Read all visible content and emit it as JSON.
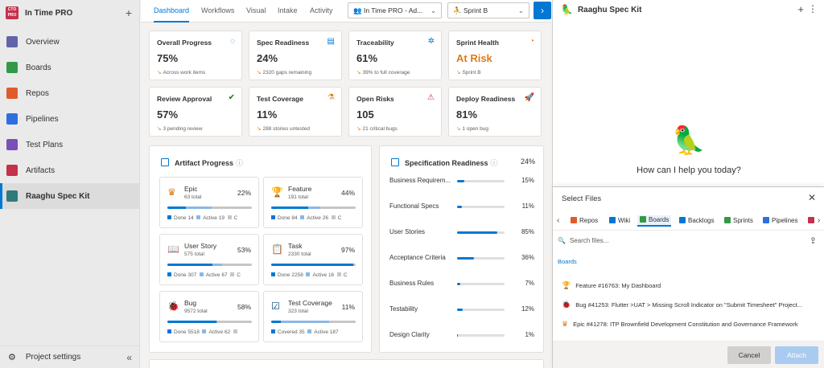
{
  "project": {
    "logo_text": "CTO PRO",
    "name": "In Time PRO"
  },
  "nav": [
    {
      "label": "Overview",
      "color": "#6264a7"
    },
    {
      "label": "Boards",
      "color": "#339947"
    },
    {
      "label": "Repos",
      "color": "#e05b2b"
    },
    {
      "label": "Pipelines",
      "color": "#2d6fe0"
    },
    {
      "label": "Test Plans",
      "color": "#7b4fb8"
    },
    {
      "label": "Artifacts",
      "color": "#c4314b"
    },
    {
      "label": "Raaghu Spec Kit",
      "color": "#2f7a7a"
    }
  ],
  "footer": {
    "settings_label": "Project settings"
  },
  "tabs": [
    "Dashboard",
    "Workflows",
    "Visual",
    "Intake",
    "Activity"
  ],
  "project_dropdown": "In Time PRO - Ad...",
  "sprint_dropdown": "Sprint B",
  "kpis": [
    {
      "title": "Overall Progress",
      "value": "75%",
      "sub": "Across work items",
      "icon": "progress-ring-icon"
    },
    {
      "title": "Spec Readiness",
      "value": "24%",
      "sub": "2320 gaps remaining",
      "icon": "checklist-icon"
    },
    {
      "title": "Traceability",
      "value": "61%",
      "sub": "39% to full coverage",
      "icon": "network-icon"
    },
    {
      "title": "Sprint Health",
      "value": "At Risk",
      "sub": "Sprint B",
      "icon": "gauge-icon",
      "value_color": "#e07a18"
    },
    {
      "title": "Review Approval",
      "value": "57%",
      "sub": "3 pending review",
      "icon": "check-circle-icon"
    },
    {
      "title": "Test Coverage",
      "value": "11%",
      "sub": "288 stories untested",
      "icon": "flask-icon"
    },
    {
      "title": "Open Risks",
      "value": "105",
      "sub": "21 critical bugs",
      "icon": "warning-icon"
    },
    {
      "title": "Deploy Readiness",
      "value": "81%",
      "sub": "1 open bug",
      "icon": "rocket-icon"
    }
  ],
  "artifact_progress": {
    "title": "Artifact Progress",
    "items": [
      {
        "name": "Epic",
        "total": "63 total",
        "pct": "22%",
        "done": "Done 14",
        "active": "Active 19",
        "done_frac": 0.22,
        "active_frac": 0.3,
        "icon": "crown-icon",
        "icon_color": "#e07a18"
      },
      {
        "name": "Feature",
        "total": "191 total",
        "pct": "44%",
        "done": "Done 84",
        "active": "Active 26",
        "done_frac": 0.44,
        "active_frac": 0.14,
        "icon": "trophy-icon",
        "icon_color": "#773adc"
      },
      {
        "name": "User Story",
        "total": "575 total",
        "pct": "53%",
        "done": "Done 307",
        "active": "Active 67",
        "done_frac": 0.53,
        "active_frac": 0.12,
        "icon": "book-icon",
        "icon_color": "#0078d4"
      },
      {
        "name": "Task",
        "total": "2330 total",
        "pct": "97%",
        "done": "Done 2258",
        "active": "Active 16",
        "done_frac": 0.97,
        "active_frac": 0.01,
        "icon": "clipboard-icon",
        "icon_color": "#a48800"
      },
      {
        "name": "Bug",
        "total": "9572 total",
        "pct": "58%",
        "done": "Done 5518",
        "active": "Active 62",
        "done_frac": 0.58,
        "active_frac": 0.01,
        "icon": "bug-icon",
        "icon_color": "#cc293d"
      },
      {
        "name": "Test Coverage",
        "total": "323 total",
        "pct": "11%",
        "done": "Covered 35",
        "active": "Active 187",
        "done_frac": 0.11,
        "active_frac": 0.58,
        "icon": "test-check-icon",
        "icon_color": "#004578"
      }
    ]
  },
  "spec_readiness": {
    "title": "Specification Readiness",
    "pct": "24%",
    "rows": [
      {
        "label": "Business Requirem...",
        "pct": "15%",
        "frac": 0.15
      },
      {
        "label": "Functional Specs",
        "pct": "11%",
        "frac": 0.11
      },
      {
        "label": "User Stories",
        "pct": "85%",
        "frac": 0.85
      },
      {
        "label": "Acceptance Criteria",
        "pct": "36%",
        "frac": 0.36
      },
      {
        "label": "Business Rules",
        "pct": "7%",
        "frac": 0.07
      },
      {
        "label": "Testability",
        "pct": "12%",
        "frac": 0.12
      },
      {
        "label": "Design Clarity",
        "pct": "1%",
        "frac": 0.01
      }
    ]
  },
  "assistant": {
    "title": "Raaghu Spec Kit",
    "help": "How can I help you today?"
  },
  "select_files": {
    "title": "Select Files",
    "sources": [
      {
        "label": "Repos",
        "color": "#e05b2b"
      },
      {
        "label": "Wiki",
        "color": "#0078d4"
      },
      {
        "label": "Boards",
        "color": "#339947"
      },
      {
        "label": "Backlogs",
        "color": "#0078d4"
      },
      {
        "label": "Sprints",
        "color": "#339947"
      },
      {
        "label": "Pipelines",
        "color": "#2d6fe0"
      },
      {
        "label": "",
        "color": "#c4314b"
      }
    ],
    "search_placeholder": "Search files...",
    "breadcrumb": "Boards",
    "files": [
      {
        "label": "Feature #16763: My Dashboard",
        "icon": "trophy-icon",
        "color": "#773adc"
      },
      {
        "label": "Bug #41253: Flutter >UAT > Missing Scroll Indicator on \"Submit Timesheet\" Project...",
        "icon": "bug-icon",
        "color": "#cc293d"
      },
      {
        "label": "Epic #41278: ITP Brownfield Development Constitution and Governance Framework",
        "icon": "crown-icon",
        "color": "#e07a18"
      }
    ],
    "cancel_label": "Cancel",
    "attach_label": "Attach"
  }
}
